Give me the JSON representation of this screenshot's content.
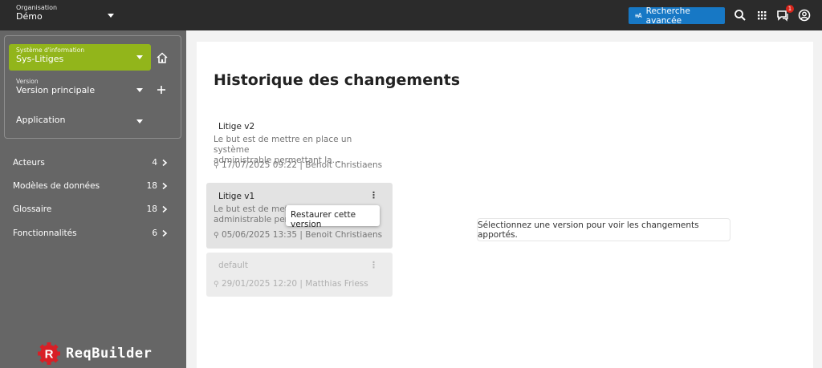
{
  "topbar": {
    "org_label": "Organisation",
    "org_value": "Démo",
    "search_label": "Recherche avancée",
    "search_icon_glyph": "≡A",
    "notifications_count": "1",
    "icons": [
      "search-icon",
      "apps-grid-icon",
      "chat-icon",
      "account-icon"
    ],
    "accent_color": "#1778c5"
  },
  "sidebar": {
    "system": {
      "label": "Système d'information",
      "value": "Sys-Litiges",
      "color": "#92b51b"
    },
    "version": {
      "label": "Version",
      "value": "Version principale"
    },
    "application": {
      "value": "Application"
    },
    "items": [
      {
        "label": "Acteurs",
        "count": "4"
      },
      {
        "label": "Modèles de données",
        "count": "18"
      },
      {
        "label": "Glossaire",
        "count": "18"
      },
      {
        "label": "Fonctionnalités",
        "count": "6"
      }
    ],
    "logo_letter": "R",
    "logo_text": "ReqBuilder"
  },
  "main": {
    "title": "Historique des changements",
    "versions": [
      {
        "name": "Litige v2",
        "desc_line1": "Le but est de mettre en place un système",
        "desc_line2": "administrable permettant la...",
        "meta": "17/07/2025 09:22 | Benoit Christiaens"
      },
      {
        "name": "Litige v1",
        "desc_line1": "Le but est de mettre",
        "desc_line2": "administrable perm",
        "meta": "05/06/2025 13:35 | Benoit Christiaens"
      },
      {
        "name": "default",
        "meta": "29/01/2025 12:20 | Matthias Friess"
      }
    ],
    "context_menu": {
      "restore_label": "Restaurer cette version"
    },
    "empty_message": "Sélectionnez une version pour voir les changements apportés."
  }
}
